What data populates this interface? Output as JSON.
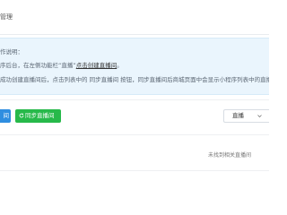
{
  "header": {
    "title": "管理"
  },
  "info": {
    "heading": "作说明：",
    "line1_prefix": "序后台，在左侧功能栏“直播”",
    "line1_link": "点击创建直播间",
    "line1_suffix": "。",
    "line2": "成功创建直播间后，点击列表中的 同步直播间 按钮，同步直播间后商城页面中会显示小程序列表中的直播"
  },
  "toolbar": {
    "left_button_label": "间",
    "sync_button_label": "同步直播间",
    "select_value": "直播"
  },
  "empty_state": {
    "text": "未找到相关直播间"
  }
}
